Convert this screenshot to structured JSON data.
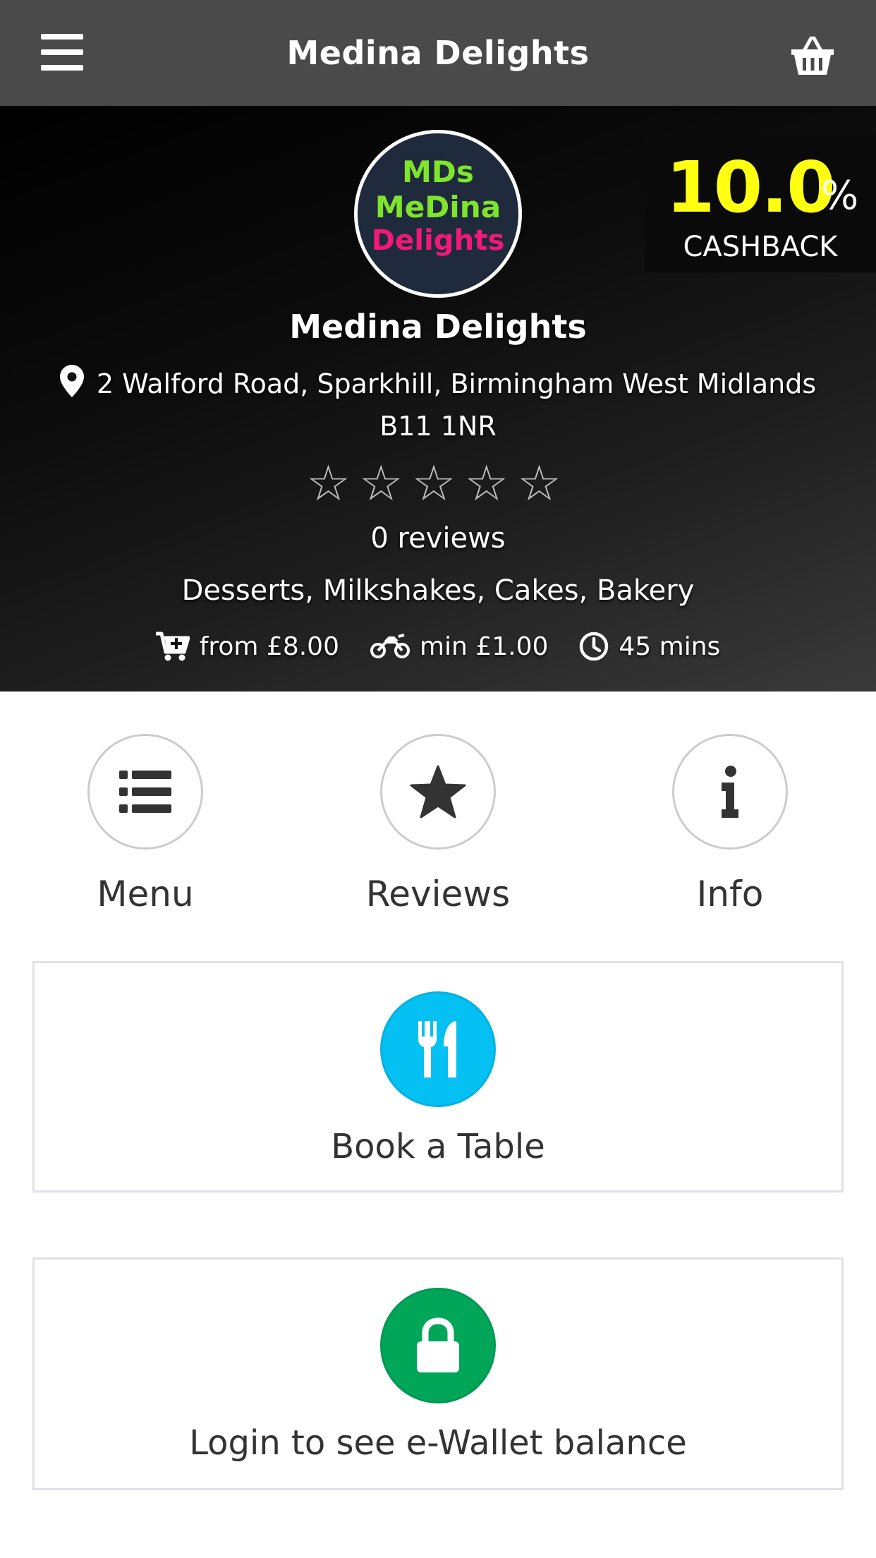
{
  "header": {
    "title": "Medina Delights"
  },
  "restaurant": {
    "name": "Medina Delights",
    "logo_text": [
      "MDs",
      "MeDina",
      "Delights"
    ],
    "address": "2 Walford Road, Sparkhill, Birmingham West Midlands B11 1NR",
    "rating_stars": "☆☆☆☆☆",
    "rating": 0,
    "reviews_label": "0 reviews",
    "cuisines": "Desserts, Milkshakes, Cakes, Bakery",
    "min_order": "from £8.00",
    "delivery": "min £1.00",
    "time": "45 mins"
  },
  "cashback": {
    "value": "10.0",
    "percent_sign": "%",
    "label": "CASHBACK",
    "color": "#ffff11"
  },
  "actions": [
    {
      "label": "Menu",
      "icon": "list-icon"
    },
    {
      "label": "Reviews",
      "icon": "star-icon"
    },
    {
      "label": "Info",
      "icon": "info-icon"
    }
  ],
  "cards": {
    "book": {
      "label": "Book a Table",
      "icon": "cutlery-icon",
      "color": "#05c0f2"
    },
    "wallet": {
      "label": "Login to see e-Wallet balance",
      "icon": "lock-icon",
      "color": "#02a659"
    }
  },
  "icons": {
    "menu": "hamburger-icon",
    "basket": "basket-icon",
    "pin": "map-pin-icon",
    "cart": "cart-plus-icon",
    "bike": "motorcycle-icon",
    "clock": "clock-icon"
  }
}
